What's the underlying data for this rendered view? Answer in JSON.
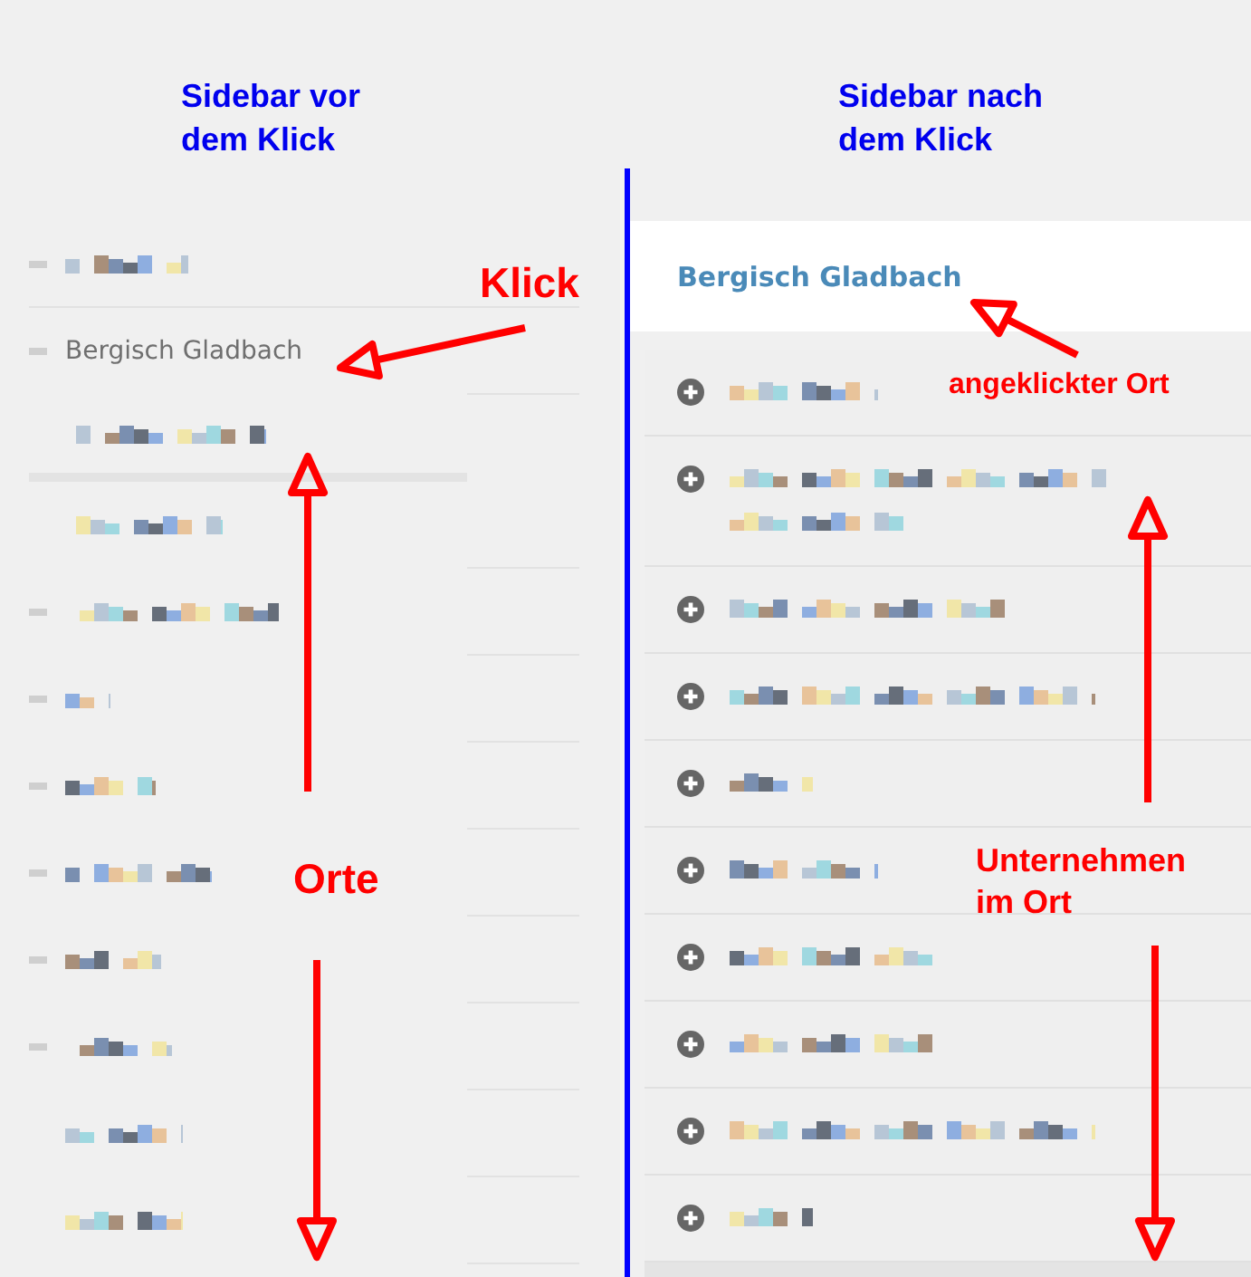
{
  "before": {
    "heading": "Sidebar vor\ndem Klick",
    "places": [
      {
        "kind": "redacted",
        "bullet": true
      },
      {
        "kind": "place",
        "label": "Bergisch Gladbach",
        "bullet": true,
        "expanded": true,
        "children": [
          {
            "kind": "redacted",
            "bullet": false
          },
          {
            "kind": "redacted",
            "bullet": false
          }
        ]
      },
      {
        "kind": "redacted",
        "bullet": true
      },
      {
        "kind": "redacted",
        "bullet": true
      },
      {
        "kind": "redacted",
        "bullet": true
      },
      {
        "kind": "redacted",
        "bullet": true
      },
      {
        "kind": "redacted",
        "bullet": true
      },
      {
        "kind": "redacted",
        "bullet": true
      },
      {
        "kind": "redacted",
        "bullet": false
      },
      {
        "kind": "redacted",
        "bullet": false
      }
    ]
  },
  "after": {
    "heading": "Sidebar nach\ndem Klick",
    "place": {
      "label": "Bergisch Gladbach",
      "selected": true
    },
    "companies": [
      {
        "wrapped": false
      },
      {
        "wrapped": true
      },
      {
        "wrapped": false
      },
      {
        "wrapped": false
      },
      {
        "wrapped": false
      },
      {
        "wrapped": false
      },
      {
        "wrapped": false
      },
      {
        "wrapped": false
      },
      {
        "wrapped": false
      },
      {
        "wrapped": false
      }
    ]
  },
  "annotations": [
    {
      "text": "Klick",
      "kind": "large"
    },
    {
      "text": "Orte",
      "kind": "large"
    },
    {
      "text": "angeklickter Ort",
      "kind": "small"
    },
    {
      "text": "Unternehmen\nim Ort",
      "kind": "medium"
    }
  ]
}
